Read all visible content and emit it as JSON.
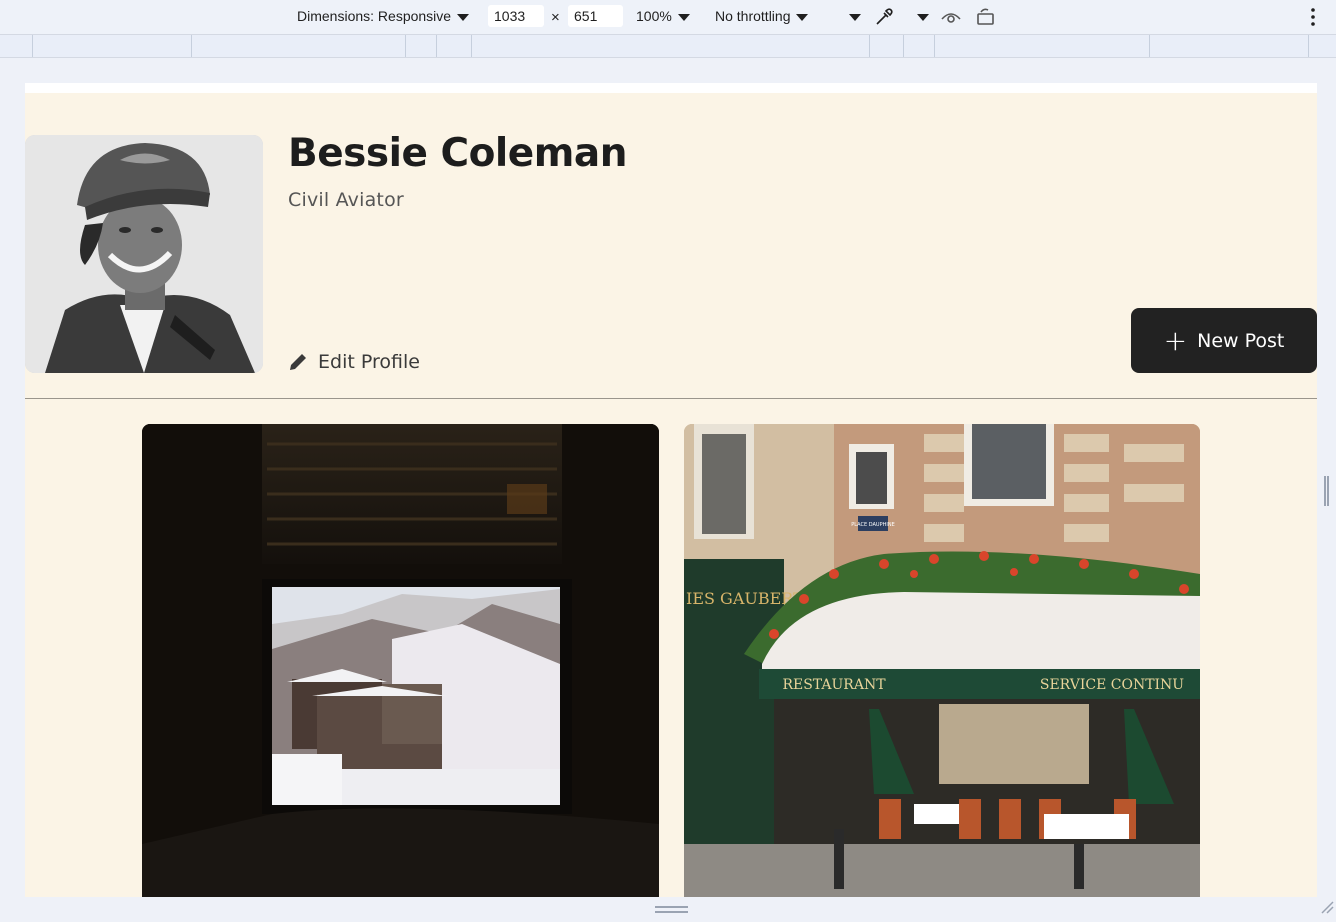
{
  "devtools": {
    "dimensions_label": "Dimensions: Responsive",
    "width_value": "1033",
    "times": "×",
    "height_value": "651",
    "zoom": "100%",
    "throttling": "No throttling"
  },
  "profile": {
    "name": "Bessie Coleman",
    "role": "Civil Aviator",
    "edit_label": "Edit Profile",
    "new_post_label": "New Post"
  },
  "posts": [
    {
      "image": "snowy-mountain-village-through-window"
    },
    {
      "image": "paris-restaurant-storefront"
    }
  ],
  "storefront": {
    "sign_left": "IES GAUBERT",
    "awning_left": "RESTAURANT",
    "awning_right": "SERVICE CONTINU",
    "street_sign": "PLACE DAUPHINE"
  },
  "colors": {
    "page_bg": "#fbf4e6",
    "button_bg": "#222222"
  }
}
